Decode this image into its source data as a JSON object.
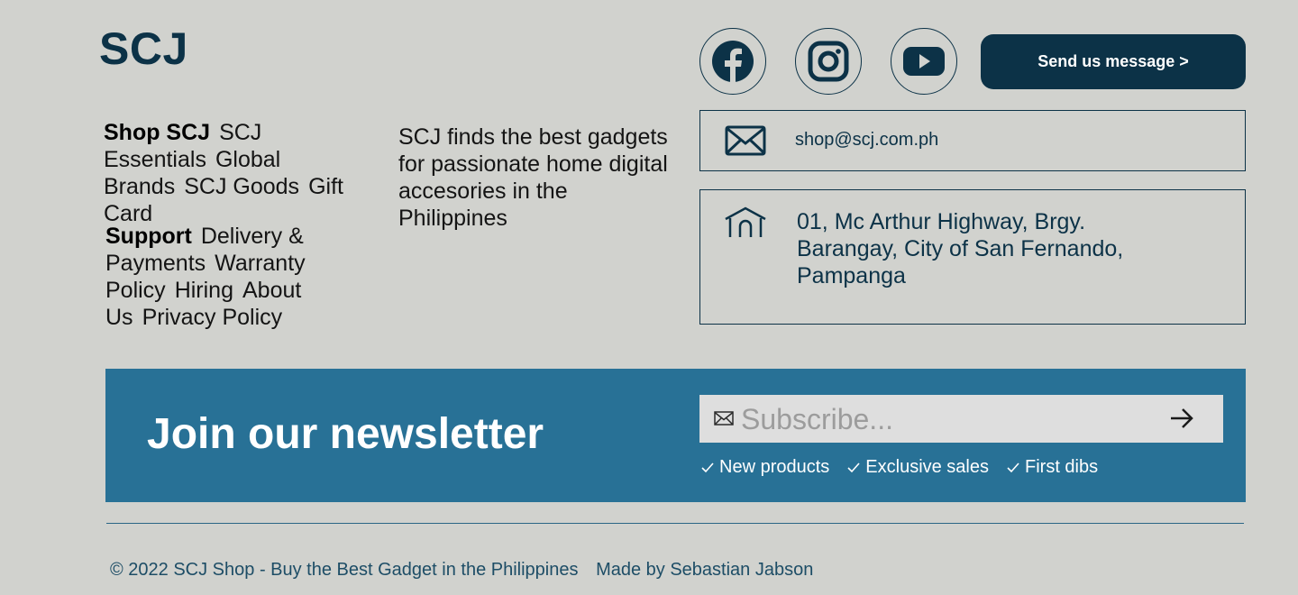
{
  "brand": {
    "logo": "SCJ"
  },
  "nav": {
    "shop_heading": "Shop SCJ",
    "shop_links": [
      "SCJ Essentials",
      "Global Brands",
      "SCJ Goods",
      "Gift Card"
    ],
    "support_heading": "Support",
    "support_links": [
      "Delivery & Payments",
      "Warranty Policy",
      "Hiring",
      "About Us",
      "Privacy Policy"
    ]
  },
  "tagline": "SCJ finds the best gadgets for passionate home digital accesories in the Philippines",
  "social": {
    "icons": [
      "facebook-icon",
      "instagram-icon",
      "youtube-icon"
    ],
    "message_button": "Send us message >"
  },
  "contact": {
    "email": "shop@scj.com.ph",
    "address": "01, Mc Arthur Highway, Brgy. Barangay, City of San Fernando, Pampanga"
  },
  "newsletter": {
    "title": "Join our newsletter",
    "placeholder": "Subscribe...",
    "perks": [
      "New products",
      "Exclusive sales",
      "First dibs"
    ]
  },
  "footer": {
    "copyright": "© 2022 SCJ Shop - Buy the Best Gadget in the Philippines",
    "credit": "Made by Sebastian Jabson"
  },
  "colors": {
    "background": "#d1d2ce",
    "primary": "#0c3247",
    "newsletter_bg": "#287196",
    "input_bg": "#dedede"
  }
}
